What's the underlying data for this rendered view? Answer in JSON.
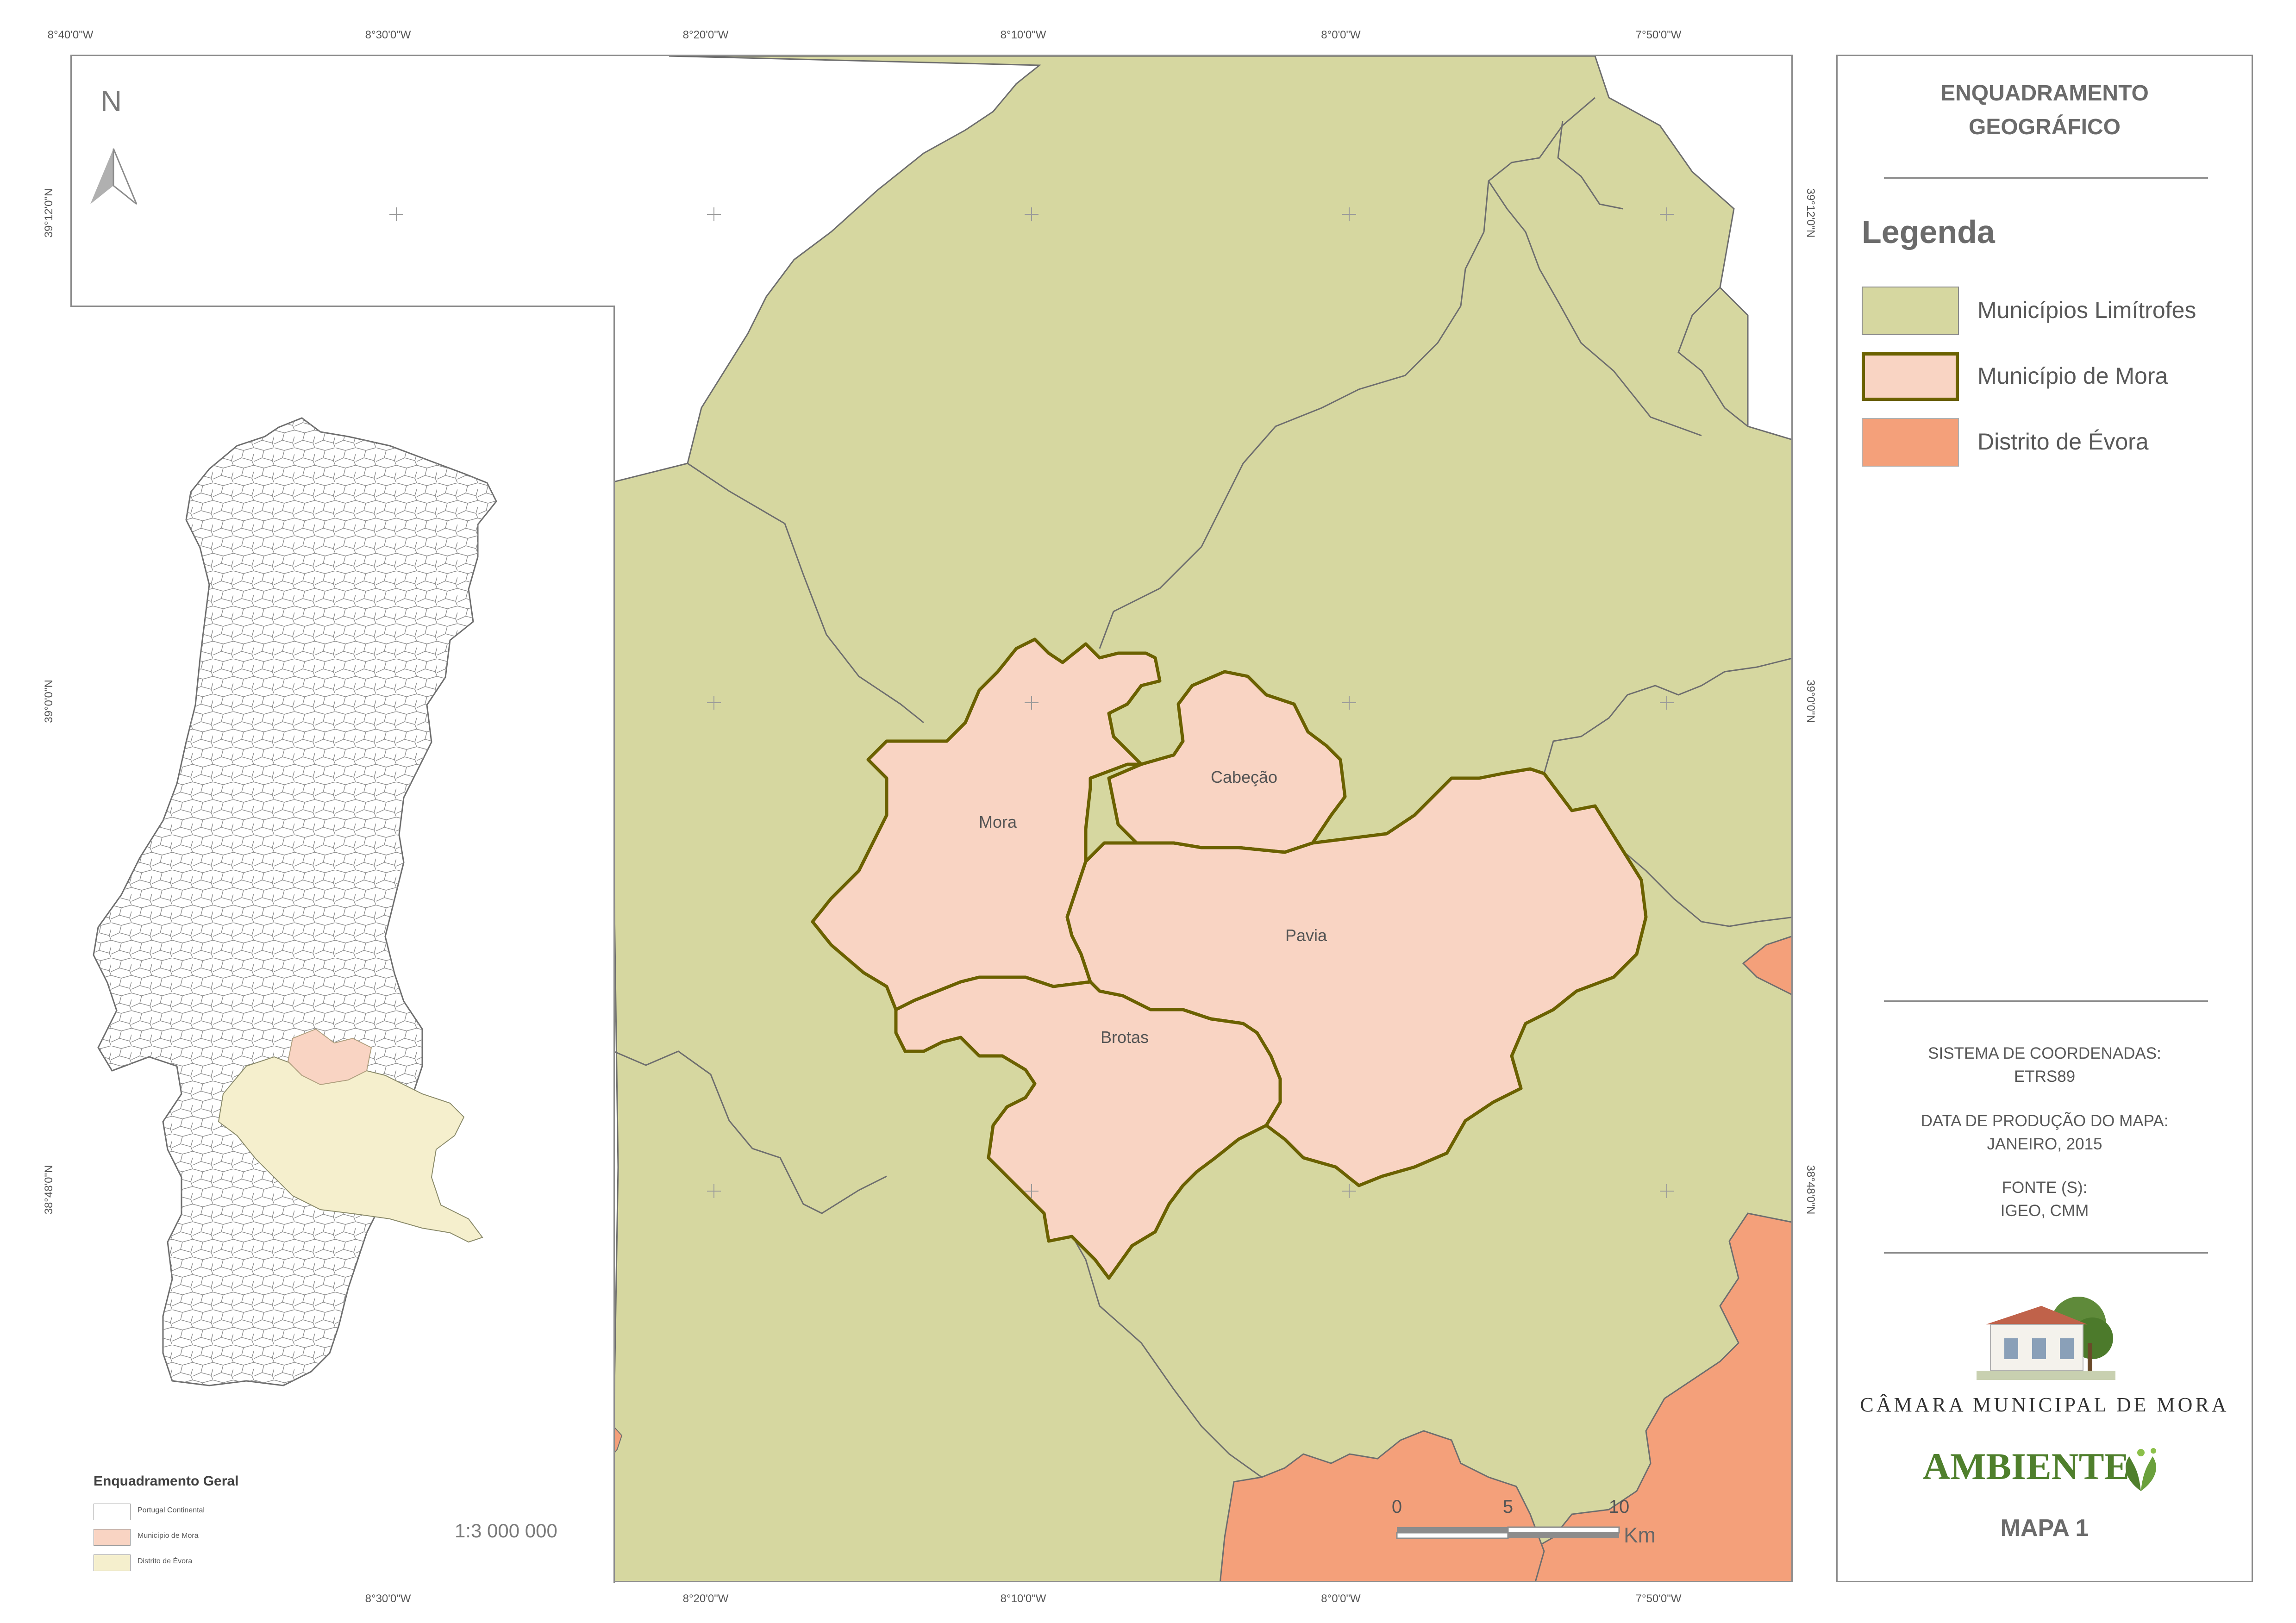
{
  "graticule": {
    "top": [
      "8°40'0\"W",
      "8°30'0\"W",
      "8°20'0\"W",
      "8°10'0\"W",
      "8°0'0\"W",
      "7°50'0\"W"
    ],
    "bottom": [
      "8°30'0\"W",
      "8°20'0\"W",
      "8°10'0\"W",
      "8°0'0\"W",
      "7°50'0\"W"
    ],
    "left": [
      "39°12'0\"N",
      "39°0'0\"N",
      "38°48'0\"N"
    ],
    "right": [
      "39°12'0\"N",
      "39°0'0\"N",
      "38°48'0\"N"
    ]
  },
  "map": {
    "north_label": "N",
    "places": [
      "Mora",
      "Cabeção",
      "Pavia",
      "Brotas"
    ],
    "scalebar": {
      "ticks": [
        "0",
        "5",
        "10"
      ],
      "unit": "Km"
    },
    "colors": {
      "municipios_limitrofes": "#d6d7a0",
      "municipio_mora": "#f9d4c3",
      "distrito_evora": "#f4a07a",
      "mora_border": "#6b6100",
      "boundary": "#6e6e6e"
    }
  },
  "inset": {
    "title": "Enquadramento Geral",
    "legend": [
      "Portugal Continental",
      "Município de Mora",
      "Distrito de Évora"
    ],
    "scale": "1:3 000 000",
    "colors": {
      "portugal": "#ffffff",
      "mora": "#f9d4c3",
      "evora": "#f5efcd"
    }
  },
  "panel": {
    "title_line1": "ENQUADRAMENTO",
    "title_line2": "GEOGRÁFICO",
    "legend_heading": "Legenda",
    "legend": [
      "Municípios Limítrofes",
      "Município de Mora",
      "Distrito de Évora"
    ],
    "coord_label": "SISTEMA DE COORDENADAS:",
    "coord_value": "ETRS89",
    "date_label": "DATA DE PRODUÇÃO DO MAPA:",
    "date_value": "JANEIRO, 2015",
    "source_label": "FONTE (S):",
    "source_value": "IGEO, CMM",
    "brand_name": "CÂMARA MUNICIPAL DE MORA",
    "brand_ambiente": "AMBIENTE",
    "map_number": "MAPA 1"
  }
}
